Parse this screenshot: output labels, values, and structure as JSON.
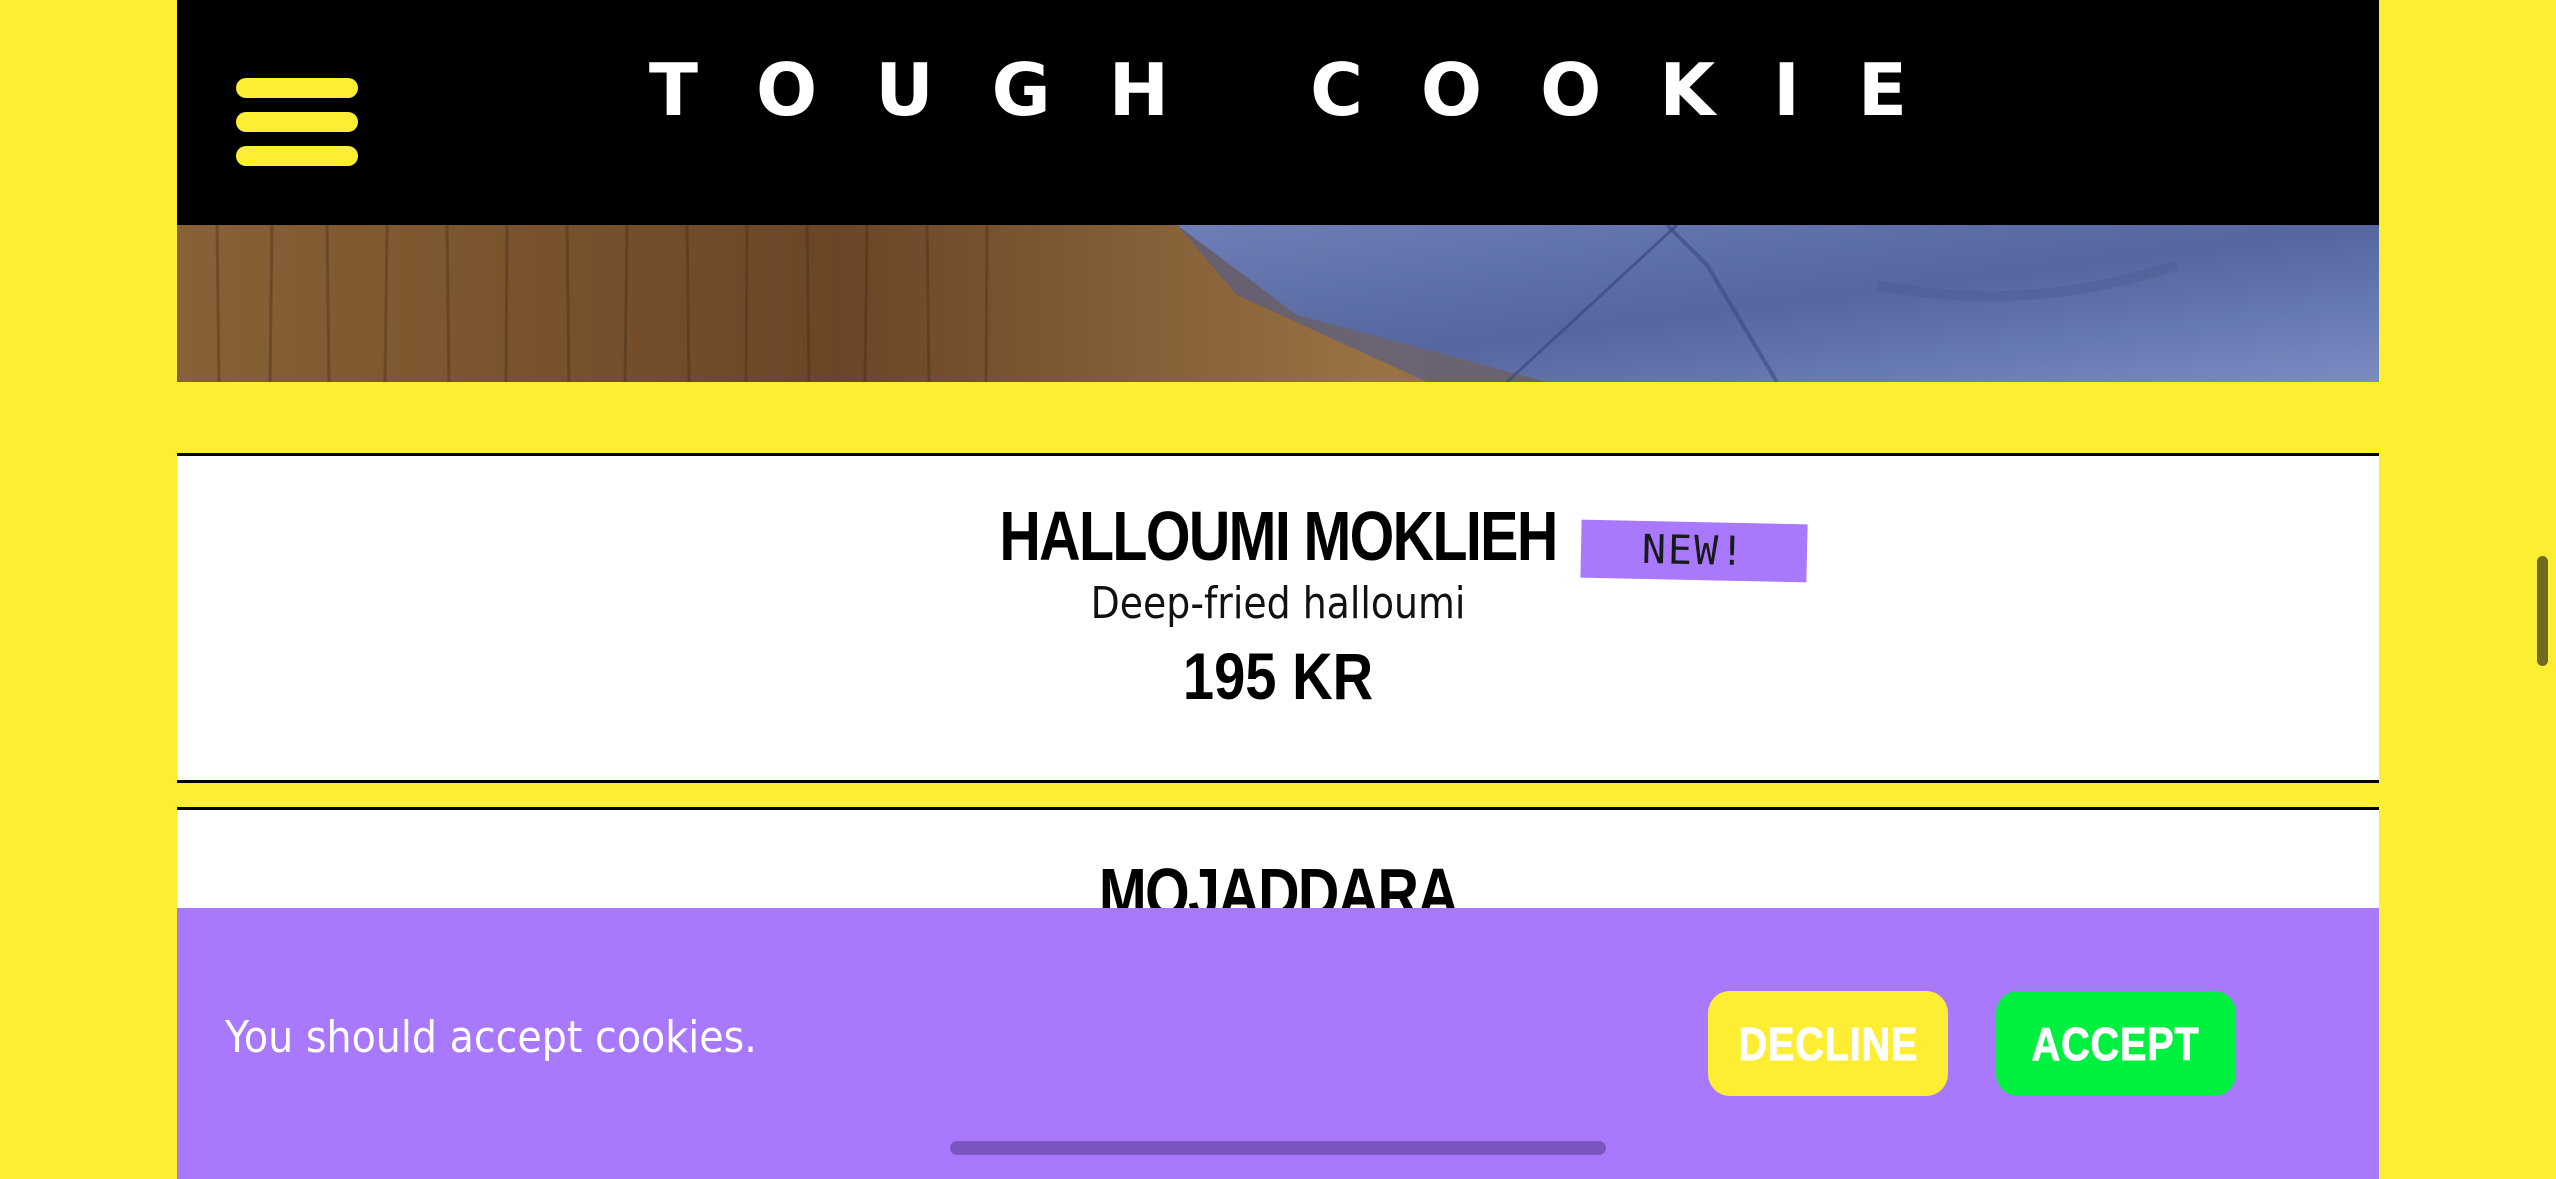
{
  "header": {
    "brand": "TOUGH COOKIE",
    "menu_icon": "hamburger-menu-icon",
    "background": "#000000",
    "accent": "#fdee34"
  },
  "hero": {
    "image": "wooden table with blue linen cloth"
  },
  "menu_items": [
    {
      "name": "HALLOUMI MOKLIEH",
      "description": "Deep-fried halloumi",
      "price": "195 KR",
      "badge": "NEW!"
    },
    {
      "name": "MOJADDARA"
    }
  ],
  "cookie_banner": {
    "message": "You should accept cookies.",
    "decline_label": "DECLINE",
    "accept_label": "ACCEPT",
    "background": "#a879fc",
    "decline_color": "#fdee34",
    "accept_color": "#00f03f"
  },
  "colors": {
    "page_background": "#fdee34",
    "badge": "#a879fc"
  }
}
